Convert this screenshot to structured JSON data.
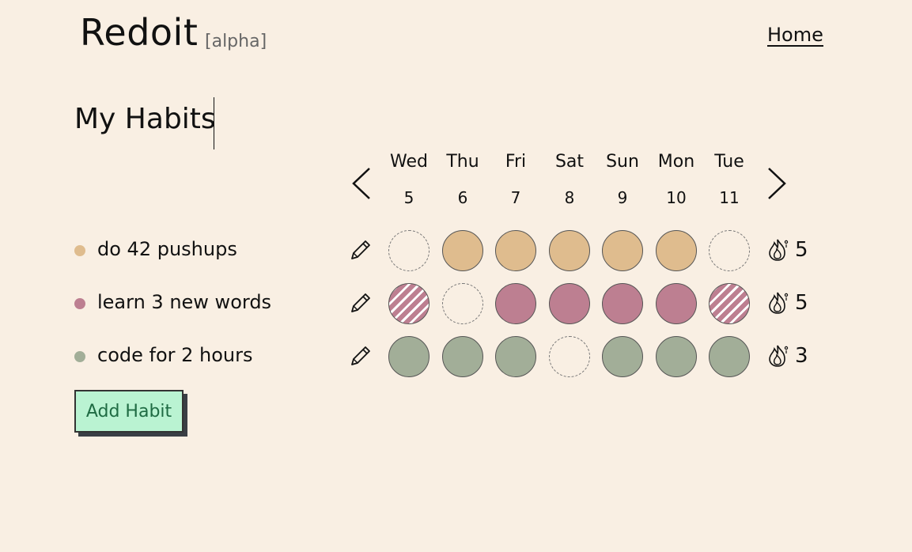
{
  "header": {
    "logo": "Redoit",
    "tag": "[alpha]",
    "home_link": "Home"
  },
  "page": {
    "title": "My Habits"
  },
  "days": [
    {
      "name": "Wed",
      "num": "5"
    },
    {
      "name": "Thu",
      "num": "6"
    },
    {
      "name": "Fri",
      "num": "7"
    },
    {
      "name": "Sat",
      "num": "8"
    },
    {
      "name": "Sun",
      "num": "9"
    },
    {
      "name": "Mon",
      "num": "10"
    },
    {
      "name": "Tue",
      "num": "11"
    }
  ],
  "habits": [
    {
      "name": "do 42 pushups",
      "color": "#dfbc8e",
      "streak": "5",
      "status": [
        "empty",
        "done",
        "done",
        "done",
        "done",
        "done",
        "empty"
      ]
    },
    {
      "name": "learn 3 new words",
      "color": "#bd7f91",
      "streak": "5",
      "status": [
        "skipped",
        "empty",
        "done",
        "done",
        "done",
        "done",
        "skipped"
      ]
    },
    {
      "name": "code for 2 hours",
      "color": "#a2ae98",
      "streak": "3",
      "status": [
        "done",
        "done",
        "done",
        "empty",
        "done",
        "done",
        "done"
      ]
    }
  ],
  "actions": {
    "add_habit": "Add Habit"
  },
  "icons": {
    "prev": "chevron-left-icon",
    "next": "chevron-right-icon",
    "edit": "pencil-icon",
    "streak": "flame-icon"
  }
}
